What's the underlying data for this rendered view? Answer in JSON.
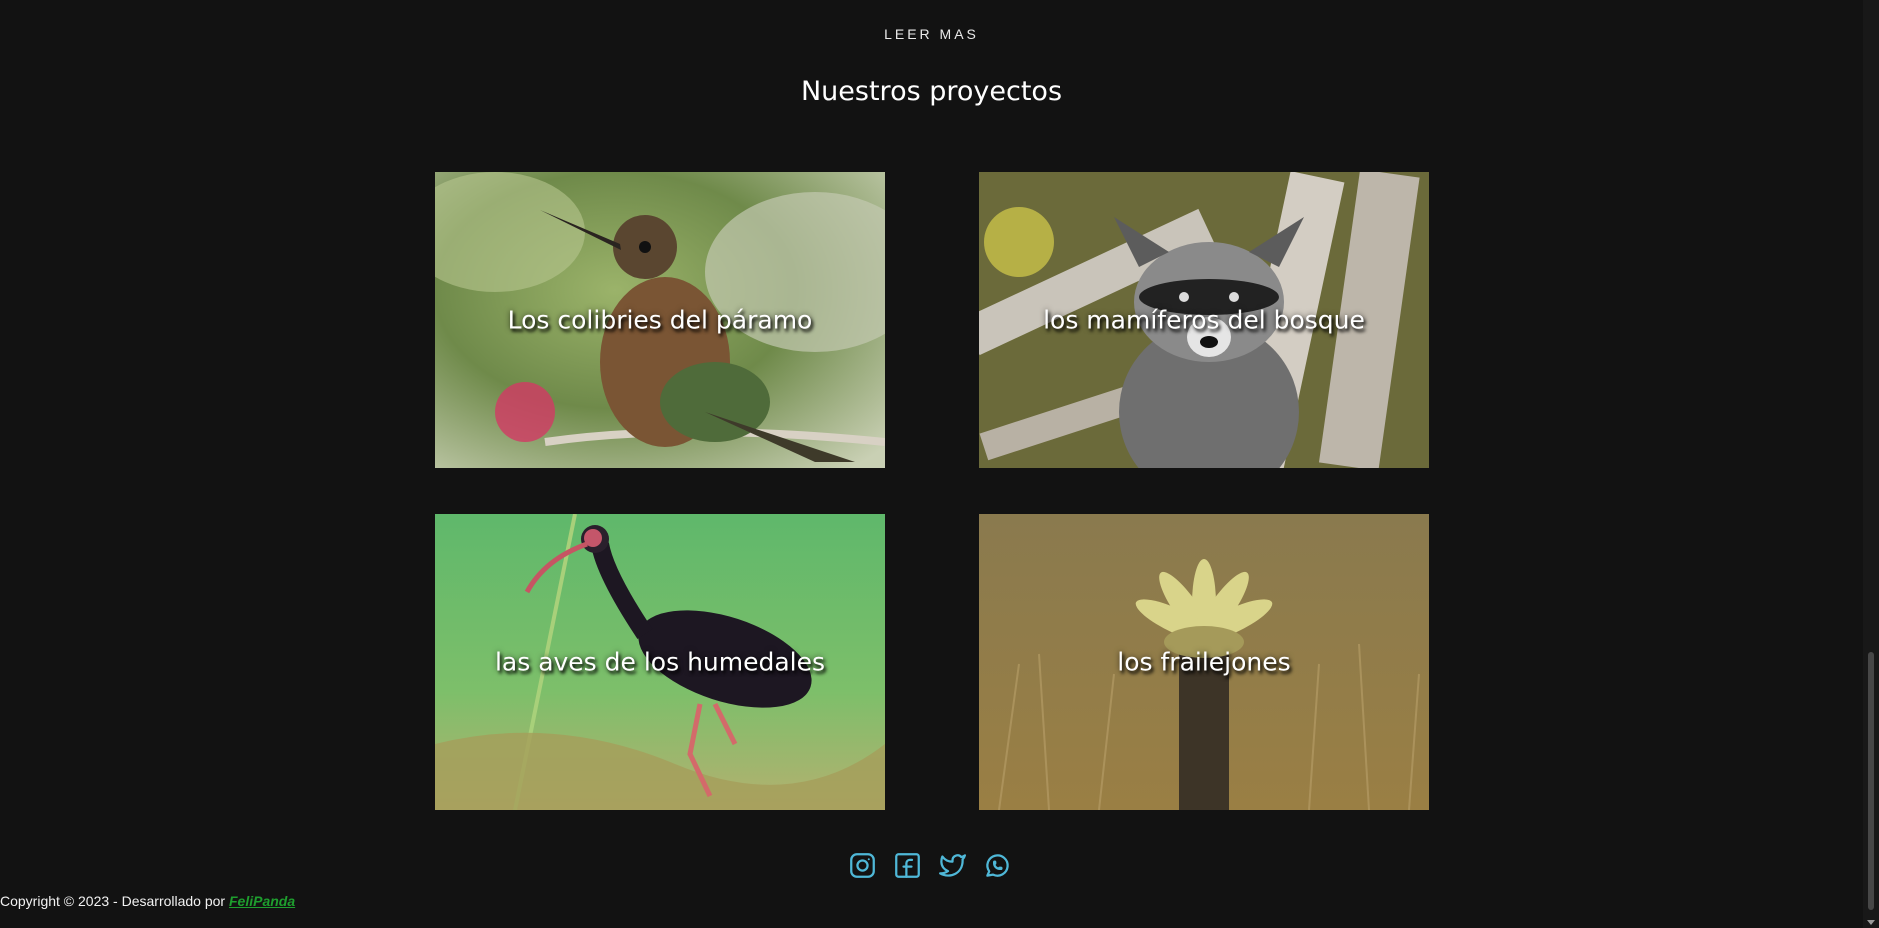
{
  "header": {
    "read_more_label": "LEER MAS",
    "section_title": "Nuestros proyectos"
  },
  "projects": [
    {
      "title": "Los colibries del páramo",
      "image_subject": "hummingbird on branch"
    },
    {
      "title": "los mamíferos del bosque",
      "image_subject": "raccoon among branches"
    },
    {
      "title": "las aves de los humedales",
      "image_subject": "black ibis in green wetland"
    },
    {
      "title": "los frailejones",
      "image_subject": "frailejon plant in dry grass"
    }
  ],
  "social": {
    "icons": [
      "instagram-icon",
      "facebook-icon",
      "twitter-icon",
      "whatsapp-icon"
    ],
    "icon_color": "#4fb8d8"
  },
  "footer": {
    "copyright_text": "Copyright © 2023 - Desarrollado por ",
    "author": "FeliPanda",
    "author_color": "#1e9e2e"
  },
  "colors": {
    "background": "#121212",
    "text": "#ffffff"
  }
}
